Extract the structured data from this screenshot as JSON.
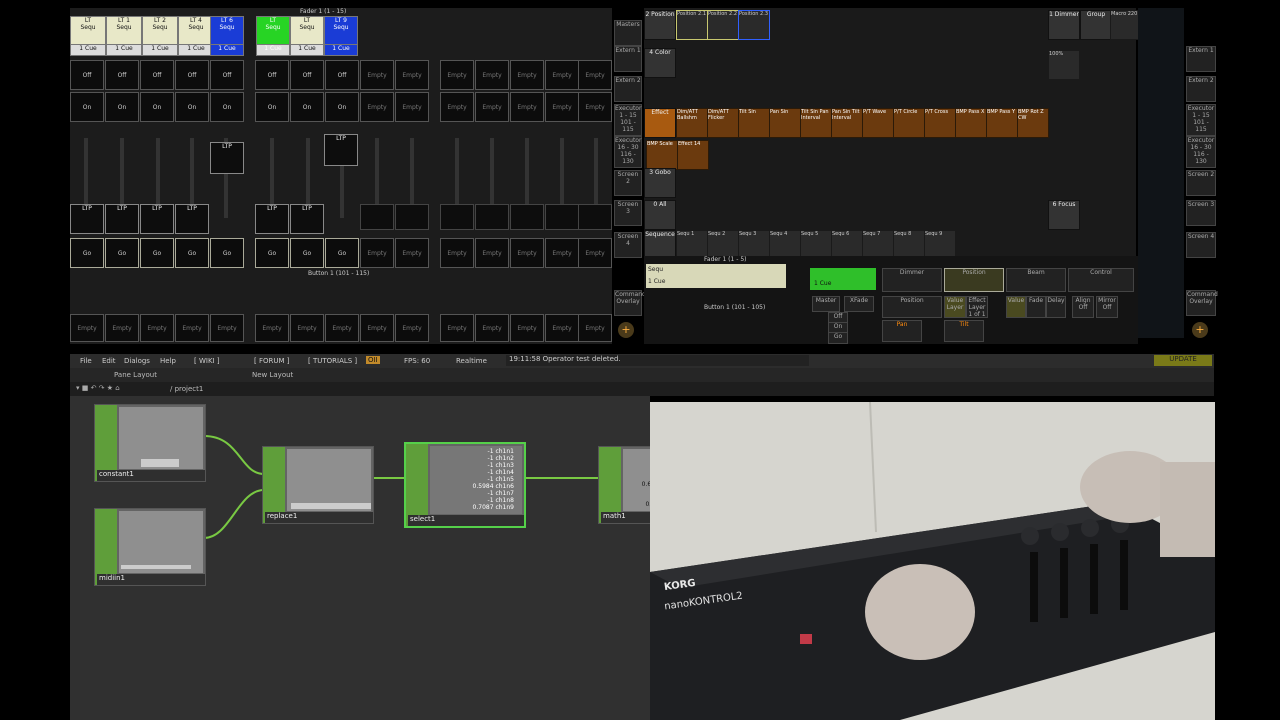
{
  "exec_header": "Fader 1 (1 - 15)",
  "button_header": "Button 1 (101 - 115)",
  "columns": [
    {
      "top": "LT",
      "mid": "Sequ",
      "cue": "1 Cue"
    },
    {
      "top": "LT 1",
      "mid": "Sequ",
      "cue": "1 Cue"
    },
    {
      "top": "LT 2",
      "mid": "Sequ",
      "cue": "1 Cue"
    },
    {
      "top": "LT 4",
      "mid": "Sequ",
      "cue": "1 Cue"
    },
    {
      "top": "LT 6",
      "mid": "Sequ",
      "cue": "1 Cue"
    },
    {
      "top": "LT",
      "mid": "Sequ",
      "cue": "1 Cue"
    },
    {
      "top": "LT",
      "mid": "Sequ",
      "cue": "1 Cue"
    },
    {
      "top": "LT 9",
      "mid": "Sequ",
      "cue": "1 Cue"
    }
  ],
  "btn_off": "Off",
  "btn_on": "On",
  "btn_empty": "Empty",
  "btn_go": "Go",
  "ltp": "LTP",
  "side_left": [
    "Masters",
    "Extern 1",
    "Extern 2",
    "Executor 1 - 15 101 - 115",
    "Executor 16 - 30 116 - 130",
    "Screen 2",
    "Screen 3",
    "Screen 4",
    "Command Overlay"
  ],
  "side_right": [
    "Extern 1",
    "Extern 2",
    "Executor 1 - 15 101 - 115",
    "Executor 16 - 30 116 - 130",
    "Screen 2",
    "Screen 3",
    "Screen 4",
    "Command Overlay"
  ],
  "pool_rows": [
    {
      "head": "2 Position",
      "cells": [
        "Position 2.1",
        "Position 2.2",
        "Position 2.3"
      ]
    },
    {
      "head": "4 Color",
      "cells": []
    },
    {
      "head": "Effect",
      "cells": [
        "Dim/ATT Ballshm",
        "Dim/ATT Flicker",
        "Tilt Sin",
        "Pan Sin",
        "Tilt Sin Pan Interval",
        "Pan Sin Tilt Interval",
        "P/T Wave",
        "P/T Circle",
        "P/T Cross",
        "BMP Pass X",
        "BMP Pass Y",
        "BMP Rot Z CW"
      ]
    },
    {
      "head": "Effect 2",
      "cells": [
        "BMP Scale",
        "Effect 14"
      ]
    },
    {
      "head": "3 Gobo",
      "cells": []
    },
    {
      "head": "0 All",
      "cells": []
    },
    {
      "head": "Sequence",
      "cells": [
        "Sequ 1",
        "Sequ 2",
        "Sequ 3",
        "Sequ 4",
        "Sequ 5",
        "Sequ 6",
        "Sequ 7",
        "Sequ 8",
        "Sequ 9"
      ]
    }
  ],
  "pool_right": [
    "1 Dimmer",
    "Group",
    "Macro 220",
    "100%",
    "6 Focus"
  ],
  "mini": {
    "fader_head": "Fader 1 (1 - 5)",
    "button_head": "Button 1 (101 - 105)",
    "labels": [
      "Dimmer",
      "Position",
      "Beam",
      "Control",
      "Position",
      "Value Layer",
      "Effect Layer 1 of 1",
      "Value",
      "Fade",
      "Delay",
      "Align Off",
      "Mirror Off",
      "Pan",
      "Tilt",
      "Master",
      "XFade",
      "Off",
      "On",
      "Go"
    ],
    "cue": "1 Cue",
    "tab": "Sequ"
  },
  "td_menu": [
    "File",
    "Edit",
    "Dialogs",
    "Help",
    "[ WIKI ]",
    "[ FORUM ]",
    "[ TUTORIALS ]",
    "OII",
    "FPS: 60",
    "Realtime",
    "19:11:58 Operator test deleted.",
    "UPDATE"
  ],
  "td_bar2": [
    "Pane Layout",
    "New Layout"
  ],
  "td_path": "/ project1",
  "nodes": [
    "constant1",
    "replace1",
    "select1",
    "math1",
    "midiin1"
  ],
  "select_values": [
    {
      "v": "-1",
      "n": "ch1n1"
    },
    {
      "v": "-1",
      "n": "ch1n2"
    },
    {
      "v": "-1",
      "n": "ch1n3"
    },
    {
      "v": "-1",
      "n": "ch1n4"
    },
    {
      "v": "-1",
      "n": "ch1n5"
    },
    {
      "v": "0.5984",
      "n": "ch1n6"
    },
    {
      "v": "-1",
      "n": "ch1n7"
    },
    {
      "v": "-1",
      "n": "ch1n8"
    },
    {
      "v": "0.7087",
      "n": "ch1n9"
    }
  ],
  "math_values": [
    "0.60",
    "0.6"
  ],
  "device_brand": "KORG",
  "device_model": "nanoKONTROL2"
}
